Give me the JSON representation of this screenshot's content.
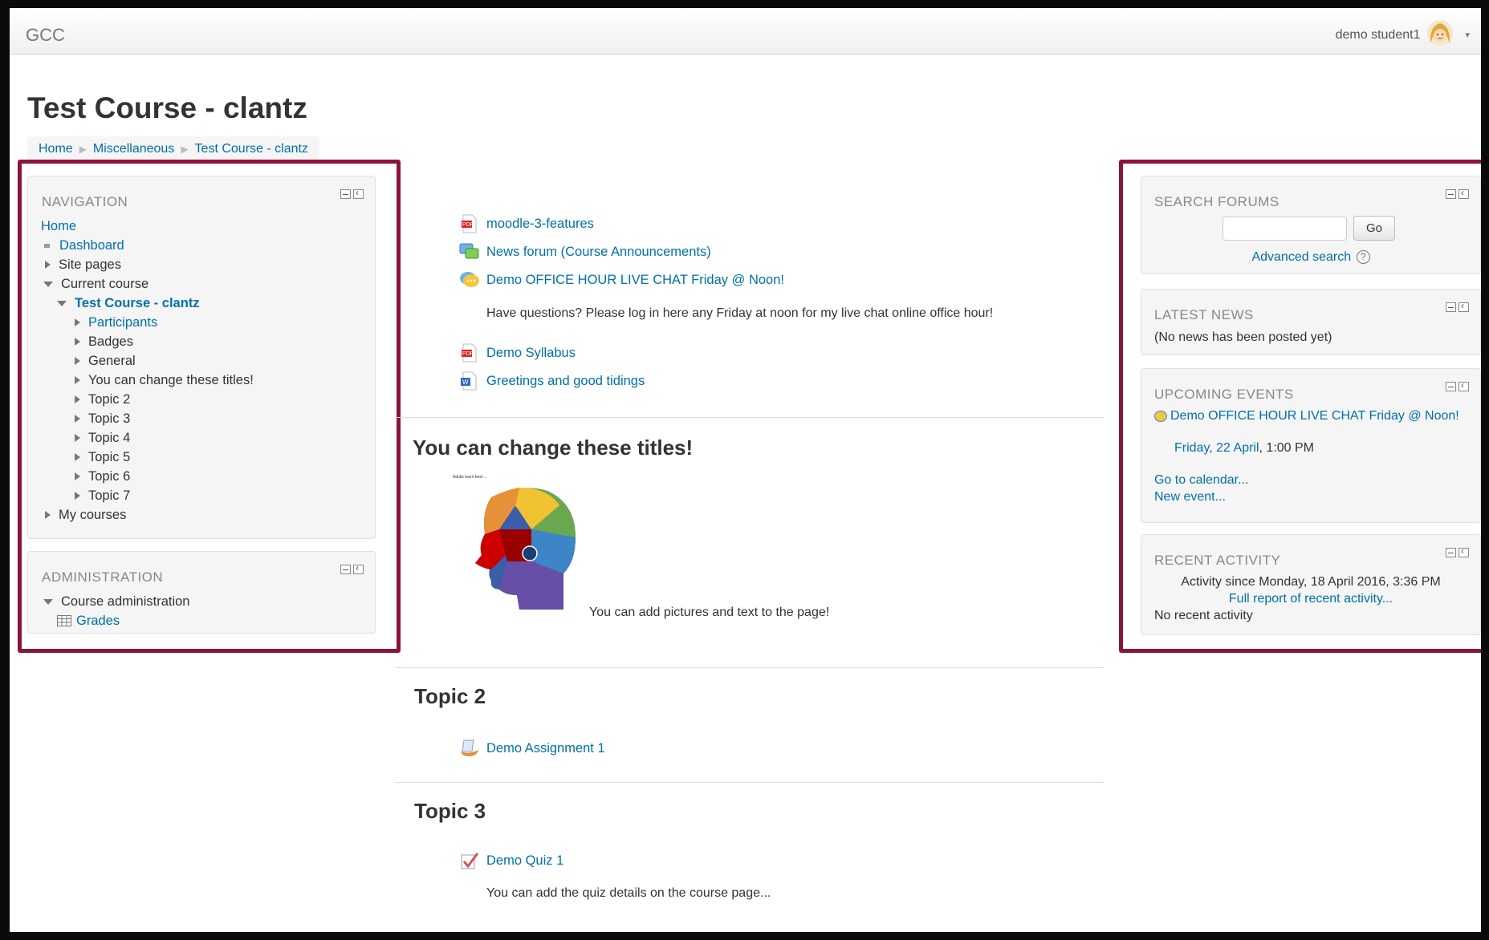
{
  "header": {
    "brand": "GCC",
    "username": "demo student1"
  },
  "page": {
    "title": "Test Course - clantz"
  },
  "breadcrumb": [
    "Home",
    "Miscellaneous",
    "Test Course - clantz"
  ],
  "navigation": {
    "title": "NAVIGATION",
    "home": "Home",
    "dashboard": "Dashboard",
    "site_pages": "Site pages",
    "current_course": "Current course",
    "course": "Test Course - clantz",
    "participants": "Participants",
    "course_items": [
      "Badges",
      "General",
      "You can change these titles!",
      "Topic 2",
      "Topic 3",
      "Topic 4",
      "Topic 5",
      "Topic 6",
      "Topic 7"
    ],
    "my_courses": "My courses"
  },
  "administration": {
    "title": "ADMINISTRATION",
    "course_admin": "Course administration",
    "grades": "Grades"
  },
  "main": {
    "resources": [
      "moodle-3-features",
      "News forum (Course Announcements)",
      "Demo OFFICE HOUR LIVE CHAT Friday @ Noon!"
    ],
    "chat_desc": "Have questions? Please log in here any Friday at noon for my live chat online office hour!",
    "resources2": [
      "Demo Syllabus",
      "Greetings and good tidings"
    ],
    "section1_title": "You can change these titles!",
    "image_caption": "Adults learn best ...",
    "section1_text": "You can add pictures and text to the page!",
    "section2_title": "Topic 2",
    "assignment": "Demo Assignment 1",
    "section3_title": "Topic 3",
    "quiz": "Demo Quiz 1",
    "quiz_desc": "You can add the quiz details on the course page..."
  },
  "search_forums": {
    "title": "SEARCH FORUMS",
    "go": "Go",
    "advanced": "Advanced search"
  },
  "latest_news": {
    "title": "LATEST NEWS",
    "empty": "(No news has been posted yet)"
  },
  "upcoming_events": {
    "title": "UPCOMING EVENTS",
    "event": "Demo OFFICE HOUR LIVE CHAT Friday @ Noon!",
    "date_link": "Friday, 22 April",
    "time": ", 1:00 PM",
    "goto_calendar": "Go to calendar...",
    "new_event": "New event..."
  },
  "recent_activity": {
    "title": "RECENT ACTIVITY",
    "since": "Activity since Monday, 18 April 2016, 3:36 PM",
    "full_report": "Full report of recent activity...",
    "none": "No recent activity"
  },
  "colors": {
    "accent_border": "#8b1538",
    "link": "#0070a8"
  }
}
